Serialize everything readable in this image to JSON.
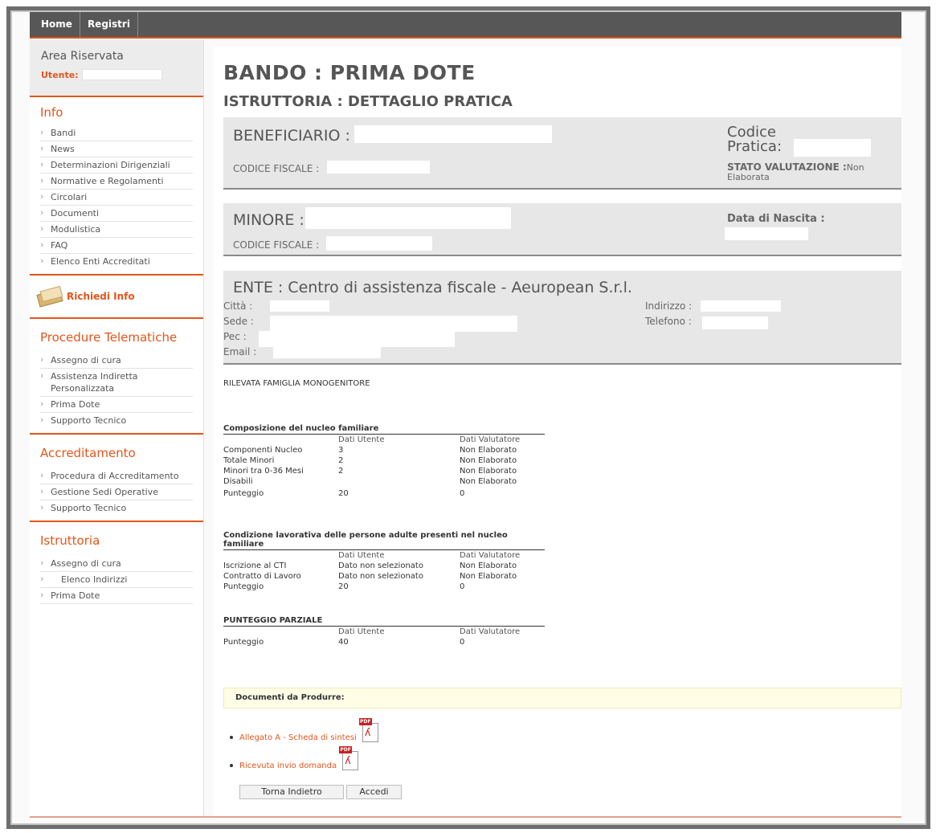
{
  "nav": {
    "home": "Home",
    "registri": "Registri"
  },
  "sidebar": {
    "area_title": "Area Riservata",
    "utente_label": "Utente:",
    "info": {
      "title": "Info",
      "items": [
        "Bandi",
        "News",
        "Determinazioni Dirigenziali",
        "Normative e Regolamenti",
        "Circolari",
        "Documenti",
        "Modulistica",
        "FAQ",
        "Elenco Enti Accreditati"
      ]
    },
    "richiedi_info": "Richiedi Info",
    "procedure": {
      "title": "Procedure Telematiche",
      "items": [
        "Assegno di cura",
        "Assistenza Indiretta Personalizzata",
        "Prima Dote",
        "Supporto Tecnico"
      ]
    },
    "accreditamento": {
      "title": "Accreditamento",
      "items": [
        "Procedura di Accreditamento",
        "Gestione Sedi Operative",
        "Supporto Tecnico"
      ]
    },
    "istruttoria": {
      "title": "Istruttoria",
      "items": [
        "Assegno di cura",
        "Elenco Indirizzi",
        "Prima Dote"
      ]
    }
  },
  "main": {
    "title": "BANDO : PRIMA DOTE",
    "subtitle": "ISTRUTTORIA : DETTAGLIO PRATICA",
    "beneficiario": {
      "label": "BENEFICIARIO :",
      "cf_label": "CODICE FISCALE :",
      "codice_pratica_label": "Codice Pratica:",
      "stato_label": "STATO VALUTAZIONE :",
      "stato_value": "Non Elaborata"
    },
    "minore": {
      "label": "MINORE :",
      "cf_label": "CODICE FISCALE :",
      "nascita_label": "Data di Nascita :"
    },
    "ente": {
      "label": "ENTE : Centro di assistenza fiscale - Aeuropean S.r.l.",
      "citta": "Città :",
      "sede": "Sede :",
      "pec": "Pec :",
      "email": "Email :",
      "indirizzo": "Indirizzo :",
      "telefono": "Telefono :"
    },
    "rilevata": "RILEVATA FAMIGLIA MONOGENITORE",
    "composizione": {
      "caption": "Composizione del nucleo familiare",
      "headers": [
        "",
        "Dati Utente",
        "Dati Valutatore"
      ],
      "rows": [
        [
          "Componenti Nucleo",
          "3",
          "Non Elaborato"
        ],
        [
          "Totale Minori",
          "2",
          "Non Elaborato"
        ],
        [
          "Minori tra 0-36 Mesi",
          "2",
          "Non Elaborato"
        ],
        [
          "Disabili",
          "",
          "Non Elaborato"
        ],
        [
          "Punteggio",
          "20",
          "0"
        ]
      ]
    },
    "condizione": {
      "caption": "Condizione lavorativa delle persone adulte presenti nel nucleo familiare",
      "headers": [
        "",
        "Dati Utente",
        "Dati Valutatore"
      ],
      "rows": [
        [
          "Iscrizione al CTI",
          "Dato non selezionato",
          "Non Elaborato"
        ],
        [
          "Contratto di Lavoro",
          "Dato non selezionato",
          "Non Elaborato"
        ],
        [
          "Punteggio",
          "20",
          "0"
        ]
      ]
    },
    "parziale": {
      "caption": "PUNTEGGIO PARZIALE",
      "headers": [
        "",
        "Dati Utente",
        "Dati Valutatore"
      ],
      "rows": [
        [
          "Punteggio",
          "40",
          "0"
        ]
      ]
    },
    "documenti_label": "Documenti da Produrre:",
    "documenti": [
      "Allegato A - Scheda di sintesi",
      "Ricevuta invio domanda"
    ],
    "pdf_tag": "PDF",
    "buttons": {
      "back": "Torna Indietro",
      "accedi": "Accedi"
    }
  },
  "colors": {
    "accent": "#e2561b",
    "topbar": "#575757",
    "box_bg": "#e7e7e7"
  }
}
